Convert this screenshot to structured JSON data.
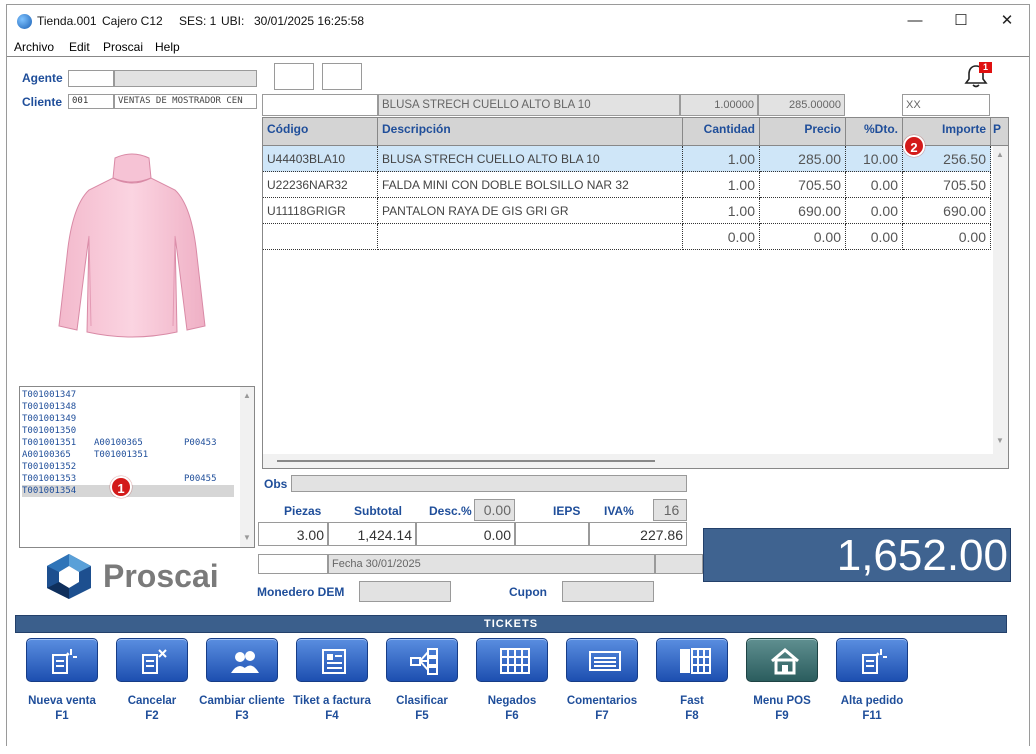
{
  "window": {
    "title": "Tienda.001",
    "cajero": "Cajero C12",
    "sesion": "SES: 1",
    "ubi": "UBI:",
    "datetime": "30/01/2025 16:25:58"
  },
  "menu": [
    "Archivo",
    "Edit",
    "Proscai",
    "Help"
  ],
  "form": {
    "agente_label": "Agente",
    "cliente_label": "Cliente",
    "cliente_code": "001",
    "cliente_name": "VENTAS DE MOSTRADOR CEN",
    "notification_count": "1"
  },
  "entry": {
    "description": "BLUSA STRECH CUELLO ALTO BLA 10",
    "quantity": "1.00000",
    "price": "285.00000",
    "code": "XX"
  },
  "grid": {
    "headers": [
      "Código",
      "Descripción",
      "Cantidad",
      "Precio",
      "%Dto.",
      "Importe",
      "P"
    ],
    "rows": [
      {
        "codigo": "U44403BLA10",
        "descripcion": "BLUSA STRECH CUELLO ALTO BLA 10",
        "cantidad": "1.00",
        "precio": "285.00",
        "dto": "10.00",
        "importe": "256.50"
      },
      {
        "codigo": "U22236NAR32",
        "descripcion": "FALDA MINI CON DOBLE BOLSILLO NAR 32",
        "cantidad": "1.00",
        "precio": "705.50",
        "dto": "0.00",
        "importe": "705.50"
      },
      {
        "codigo": "U11118GRIGR",
        "descripcion": "PANTALON RAYA DE GIS GRI GR",
        "cantidad": "1.00",
        "precio": "690.00",
        "dto": "0.00",
        "importe": "690.00"
      },
      {
        "codigo": "",
        "descripcion": "",
        "cantidad": "0.00",
        "precio": "0.00",
        "dto": "0.00",
        "importe": "0.00"
      }
    ]
  },
  "tickets_list": [
    {
      "a": "T001001347",
      "b": "",
      "c": ""
    },
    {
      "a": "T001001348",
      "b": "",
      "c": ""
    },
    {
      "a": "T001001349",
      "b": "",
      "c": ""
    },
    {
      "a": "T001001350",
      "b": "",
      "c": ""
    },
    {
      "a": "T001001351",
      "b": "A00100365",
      "c": "P00453"
    },
    {
      "a": "A00100365",
      "b": "T001001351",
      "c": ""
    },
    {
      "a": "T001001352",
      "b": "",
      "c": ""
    },
    {
      "a": "T001001353",
      "b": "",
      "c": "P00455"
    },
    {
      "a": "T001001354",
      "b": "",
      "c": ""
    }
  ],
  "markers": {
    "one": "1",
    "two": "2"
  },
  "logo": {
    "text": "Proscai"
  },
  "totals": {
    "obs_label": "Obs",
    "piezas_label": "Piezas",
    "subtotal_label": "Subtotal",
    "desc_label": "Desc.%",
    "desc_pct": "0.00",
    "ieps_label": "IEPS",
    "iva_label": "IVA%",
    "iva_pct": "16",
    "piezas": "3.00",
    "subtotal": "1,424.14",
    "descuento": "0.00",
    "iva": "227.86",
    "fecha": "Fecha 30/01/2025",
    "monedero_label": "Monedero DEM",
    "cupon_label": "Cupon",
    "total": "1,652.00"
  },
  "section_title": "TICKETS",
  "function_buttons": [
    {
      "label": "Nueva venta",
      "key": "F1",
      "icon": "new-sale-icon"
    },
    {
      "label": "Cancelar",
      "key": "F2",
      "icon": "cancel-icon"
    },
    {
      "label": "Cambiar cliente",
      "key": "F3",
      "icon": "users-icon"
    },
    {
      "label": "Tiket a factura",
      "key": "F4",
      "icon": "invoice-icon"
    },
    {
      "label": "Clasificar",
      "key": "F5",
      "icon": "classify-icon"
    },
    {
      "label": "Negados",
      "key": "F6",
      "icon": "grid-icon"
    },
    {
      "label": "Comentarios",
      "key": "F7",
      "icon": "comments-icon"
    },
    {
      "label": "Fast",
      "key": "F8",
      "icon": "fast-icon"
    },
    {
      "label": "Menu POS",
      "key": "F9",
      "icon": "home-icon"
    },
    {
      "label": "Alta pedido",
      "key": "F11",
      "icon": "new-order-icon"
    }
  ],
  "colors": {
    "accent": "#1f4e9a",
    "total_bg": "#3f6390",
    "selection": "#cfe6f8",
    "badge": "#d31a1a"
  }
}
